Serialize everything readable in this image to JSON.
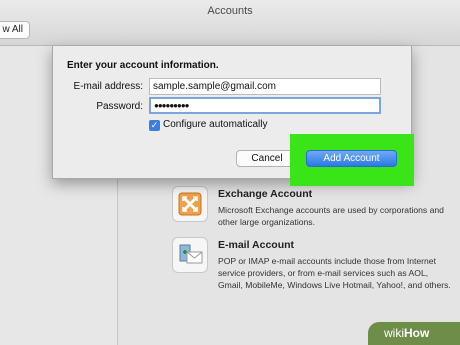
{
  "window": {
    "title": "Accounts",
    "show_all_label": "w All"
  },
  "dialog": {
    "heading": "Enter your account information.",
    "email_label": "E-mail address:",
    "email_value": "sample.sample@gmail.com",
    "password_label": "Password:",
    "password_value": "●●●●●●●●●",
    "configure_label": "Configure automatically",
    "configure_checked": true,
    "cancel_label": "Cancel",
    "add_label": "Add Account"
  },
  "accounts": [
    {
      "title": "Exchange Account",
      "description": "Microsoft Exchange accounts are used by corporations and other large organizations."
    },
    {
      "title": "E-mail Account",
      "description": "POP or IMAP e-mail accounts include those from Internet service providers, or from e-mail services such as AOL, Gmail, MobileMe, Windows Live Hotmail, Yahoo!, and others."
    }
  ],
  "watermark": {
    "prefix": "wiki",
    "suffix": "How"
  },
  "colors": {
    "highlight": "#39e516",
    "accent": "#2c79e6",
    "watermark": "#6e8d48"
  }
}
